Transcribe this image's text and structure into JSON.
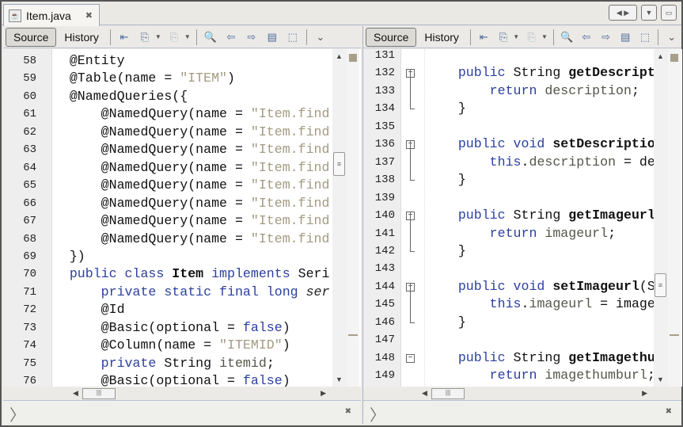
{
  "tab": {
    "title": "Item.java"
  },
  "toolbar": {
    "source": "Source",
    "history": "History"
  },
  "left": {
    "lines": [
      {
        "n": "58",
        "t": [
          [
            "    @Entity",
            "t"
          ]
        ]
      },
      {
        "n": "59",
        "t": [
          [
            "    @Table(name = ",
            "t"
          ],
          [
            "\"ITEM\"",
            "s"
          ],
          [
            ")",
            "t"
          ]
        ]
      },
      {
        "n": "60",
        "t": [
          [
            "    @NamedQueries({",
            "t"
          ]
        ]
      },
      {
        "n": "61",
        "t": [
          [
            "        @NamedQuery(name = ",
            "t"
          ],
          [
            "\"Item.find",
            "s"
          ]
        ]
      },
      {
        "n": "62",
        "t": [
          [
            "        @NamedQuery(name = ",
            "t"
          ],
          [
            "\"Item.find",
            "s"
          ]
        ]
      },
      {
        "n": "63",
        "t": [
          [
            "        @NamedQuery(name = ",
            "t"
          ],
          [
            "\"Item.find",
            "s"
          ]
        ]
      },
      {
        "n": "64",
        "t": [
          [
            "        @NamedQuery(name = ",
            "t"
          ],
          [
            "\"Item.find",
            "s"
          ]
        ]
      },
      {
        "n": "65",
        "t": [
          [
            "        @NamedQuery(name = ",
            "t"
          ],
          [
            "\"Item.find",
            "s"
          ]
        ]
      },
      {
        "n": "66",
        "t": [
          [
            "        @NamedQuery(name = ",
            "t"
          ],
          [
            "\"Item.find",
            "s"
          ]
        ]
      },
      {
        "n": "67",
        "t": [
          [
            "        @NamedQuery(name = ",
            "t"
          ],
          [
            "\"Item.find",
            "s"
          ]
        ]
      },
      {
        "n": "68",
        "t": [
          [
            "        @NamedQuery(name = ",
            "t"
          ],
          [
            "\"Item.find",
            "s"
          ]
        ]
      },
      {
        "n": "69",
        "t": [
          [
            "    })",
            "t"
          ]
        ]
      },
      {
        "n": "70",
        "t": [
          [
            "    ",
            "t"
          ],
          [
            "public class ",
            "k"
          ],
          [
            "Item",
            "b"
          ],
          [
            " implements ",
            "k"
          ],
          [
            "Seri",
            "t"
          ]
        ]
      },
      {
        "n": "71",
        "t": [
          [
            "        ",
            "t"
          ],
          [
            "private static final long ",
            "k"
          ],
          [
            "ser",
            "i"
          ]
        ]
      },
      {
        "n": "72",
        "t": [
          [
            "        @Id",
            "t"
          ]
        ]
      },
      {
        "n": "73",
        "t": [
          [
            "        @Basic(optional = ",
            "t"
          ],
          [
            "false",
            "k"
          ],
          [
            ")",
            "t"
          ]
        ]
      },
      {
        "n": "74",
        "t": [
          [
            "        @Column(name = ",
            "t"
          ],
          [
            "\"ITEMID\"",
            "s"
          ],
          [
            ")",
            "t"
          ]
        ]
      },
      {
        "n": "75",
        "t": [
          [
            "        ",
            "t"
          ],
          [
            "private ",
            "k"
          ],
          [
            "String ",
            "t"
          ],
          [
            "itemid",
            "f"
          ],
          [
            ";",
            "t"
          ]
        ]
      },
      {
        "n": "76",
        "t": [
          [
            "        @Basic(optional = ",
            "t"
          ],
          [
            "false",
            "k"
          ],
          [
            ")",
            "t"
          ]
        ]
      }
    ]
  },
  "right": {
    "lines": [
      {
        "n": "131",
        "t": []
      },
      {
        "n": "132",
        "fold": "start",
        "t": [
          [
            "    ",
            "t"
          ],
          [
            "public ",
            "k"
          ],
          [
            "String ",
            "t"
          ],
          [
            "getDescript",
            "b"
          ]
        ]
      },
      {
        "n": "133",
        "t": [
          [
            "        ",
            "t"
          ],
          [
            "return ",
            "k"
          ],
          [
            "description",
            "f"
          ],
          [
            ";",
            "t"
          ]
        ]
      },
      {
        "n": "134",
        "fold": "end",
        "t": [
          [
            "    }",
            "t"
          ]
        ]
      },
      {
        "n": "135",
        "t": []
      },
      {
        "n": "136",
        "fold": "start",
        "t": [
          [
            "    ",
            "t"
          ],
          [
            "public void ",
            "k"
          ],
          [
            "setDescriptio",
            "b"
          ]
        ]
      },
      {
        "n": "137",
        "t": [
          [
            "        ",
            "t"
          ],
          [
            "this",
            "k"
          ],
          [
            ".",
            "t"
          ],
          [
            "description",
            "f"
          ],
          [
            " = de",
            "t"
          ]
        ]
      },
      {
        "n": "138",
        "fold": "end",
        "t": [
          [
            "    }",
            "t"
          ]
        ]
      },
      {
        "n": "139",
        "t": []
      },
      {
        "n": "140",
        "fold": "start",
        "t": [
          [
            "    ",
            "t"
          ],
          [
            "public ",
            "k"
          ],
          [
            "String ",
            "t"
          ],
          [
            "getImageurl",
            "b"
          ]
        ]
      },
      {
        "n": "141",
        "t": [
          [
            "        ",
            "t"
          ],
          [
            "return ",
            "k"
          ],
          [
            "imageurl",
            "f"
          ],
          [
            ";",
            "t"
          ]
        ]
      },
      {
        "n": "142",
        "fold": "end",
        "t": [
          [
            "    }",
            "t"
          ]
        ]
      },
      {
        "n": "143",
        "t": []
      },
      {
        "n": "144",
        "fold": "start",
        "t": [
          [
            "    ",
            "t"
          ],
          [
            "public void ",
            "k"
          ],
          [
            "setImageurl",
            "b"
          ],
          [
            "(S",
            "t"
          ]
        ]
      },
      {
        "n": "145",
        "t": [
          [
            "        ",
            "t"
          ],
          [
            "this",
            "k"
          ],
          [
            ".",
            "t"
          ],
          [
            "imageurl",
            "f"
          ],
          [
            " = image",
            "t"
          ]
        ]
      },
      {
        "n": "146",
        "fold": "end",
        "t": [
          [
            "    }",
            "t"
          ]
        ]
      },
      {
        "n": "147",
        "t": []
      },
      {
        "n": "148",
        "fold": "start",
        "t": [
          [
            "    ",
            "t"
          ],
          [
            "public ",
            "k"
          ],
          [
            "String ",
            "t"
          ],
          [
            "getImagethu",
            "b"
          ]
        ]
      },
      {
        "n": "149",
        "t": [
          [
            "        ",
            "t"
          ],
          [
            "return ",
            "k"
          ],
          [
            "imagethumburl",
            "f"
          ],
          [
            ";",
            "t"
          ]
        ]
      }
    ]
  }
}
